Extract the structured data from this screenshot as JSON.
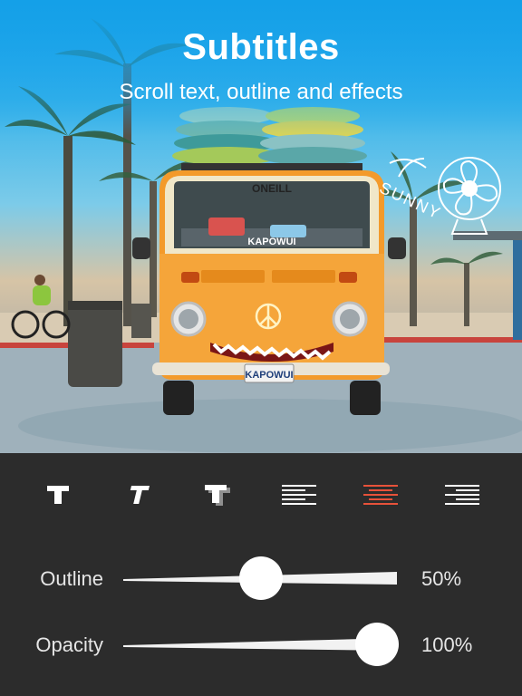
{
  "header": {
    "title": "Subtitles",
    "subtitle": "Scroll text, outline and effects"
  },
  "photo": {
    "sticker_text": "SUNNY",
    "van_brand": "ONEILL",
    "plate": "KAPOWUI",
    "windshield_text": "KAPOWUI"
  },
  "toolbar": {
    "items": [
      {
        "name": "text-style-bold",
        "icon": "bold-t-icon"
      },
      {
        "name": "text-style-italic",
        "icon": "italic-t-icon"
      },
      {
        "name": "text-style-shadow",
        "icon": "shadow-t-icon"
      },
      {
        "name": "align-left",
        "icon": "align-left-icon"
      },
      {
        "name": "align-center",
        "icon": "align-center-icon",
        "selected": true
      },
      {
        "name": "align-right",
        "icon": "align-right-icon"
      }
    ],
    "active_color": "#e8523a",
    "icon_color": "#ffffff"
  },
  "sliders": {
    "outline": {
      "label": "Outline",
      "value_text": "50%",
      "value": 0.5
    },
    "opacity": {
      "label": "Opacity",
      "value_text": "100%",
      "value": 1.0
    }
  }
}
